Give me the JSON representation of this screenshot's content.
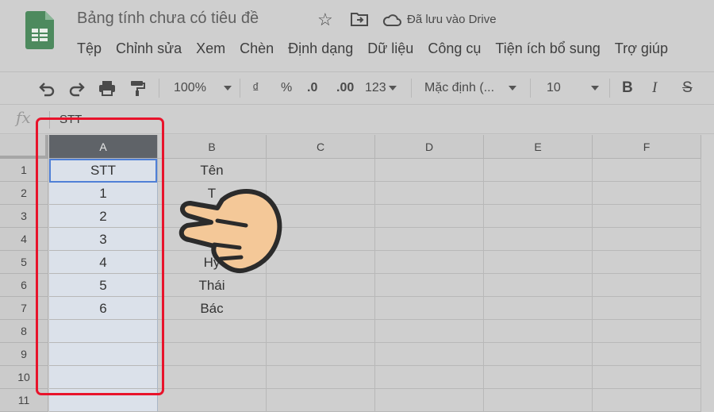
{
  "header": {
    "doc_title": "Bảng tính chưa có tiêu đề",
    "saved_status": "Đã lưu vào Drive",
    "icons": {
      "logo": "sheets-logo-icon",
      "star": "star-icon",
      "move": "move-to-folder-icon",
      "cloud": "cloud-saved-icon"
    }
  },
  "menu": [
    "Tệp",
    "Chỉnh sửa",
    "Xem",
    "Chèn",
    "Định dạng",
    "Dữ liệu",
    "Công cụ",
    "Tiện ích bổ sung",
    "Trợ giúp"
  ],
  "toolbar": {
    "zoom": "100%",
    "currency": "₫",
    "percent": "%",
    "dec_decrease": ".0",
    "dec_increase": ".00",
    "more_formats": "123",
    "font": "Mặc định (...",
    "font_size": "10",
    "bold": "B",
    "italic": "I",
    "strike": "S"
  },
  "formula_bar": {
    "fx": "fx",
    "value": "STT"
  },
  "grid": {
    "columns": [
      "A",
      "B",
      "C",
      "D",
      "E",
      "F"
    ],
    "selected_column": "A",
    "rows": [
      "1",
      "2",
      "3",
      "4",
      "5",
      "6",
      "7",
      "8",
      "9",
      "10",
      "11"
    ],
    "col_a": [
      "STT",
      "1",
      "2",
      "3",
      "4",
      "5",
      "6",
      "",
      "",
      "",
      ""
    ],
    "col_b": [
      "Tên",
      "T",
      "",
      "",
      "Hy",
      "Thái",
      "Bác",
      "",
      "",
      "",
      ""
    ]
  },
  "colors": {
    "highlight": "#e8132b",
    "selected_header": "#5f6368",
    "selection_fill": "#dbe1ea",
    "active_border": "#4f7fd6"
  }
}
